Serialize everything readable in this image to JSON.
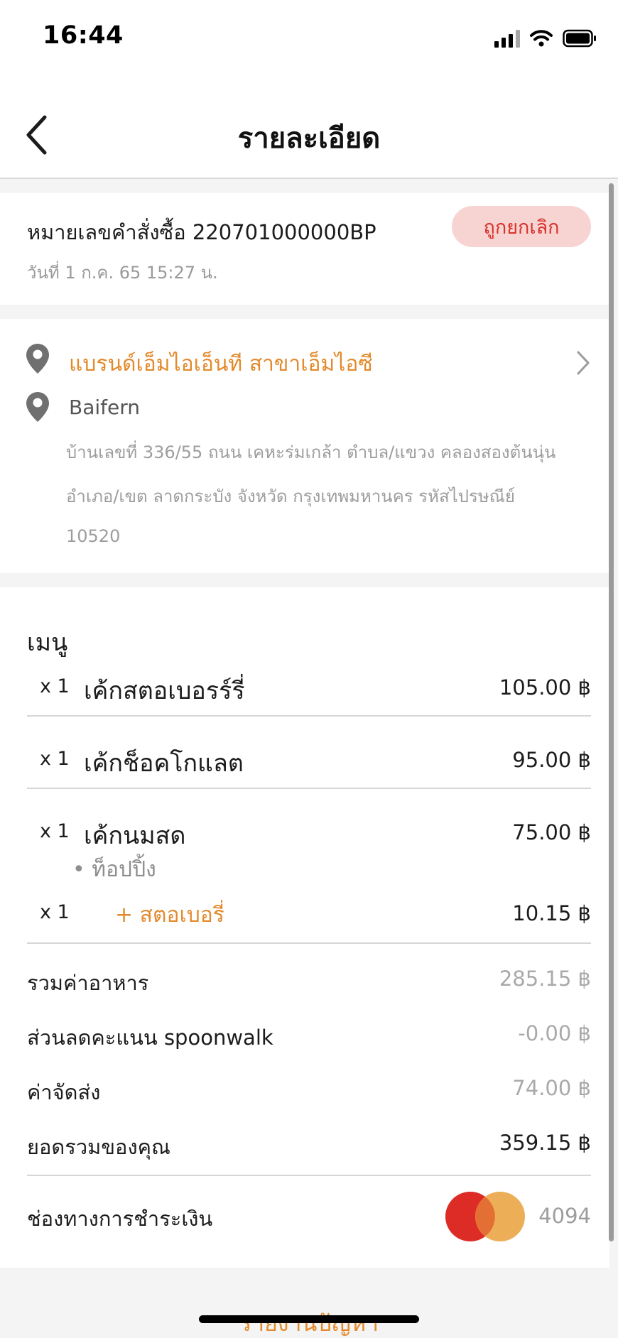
{
  "status_bar": {
    "time": "16:44"
  },
  "nav": {
    "title": "รายละเอียด"
  },
  "order": {
    "number_text": "หมายเลขคำสั่งซื้อ 220701000000BP",
    "date_text": "วันที่ 1 ก.ค. 65 15:27 น.",
    "status": "ถูกยกเลิก"
  },
  "address": {
    "store_name": "แบรนด์เอ็มไอเอ็นที สาขาเอ็มไอซี",
    "customer_name": "Baifern",
    "lines": [
      "บ้านเลขที่ 336/55 ถนน เคหะร่มเกล้า ตำบล/แขวง คลองสองต้นนุ่น",
      "อำเภอ/เขต ลาดกระบัง จังหวัด กรุงเทพมหานคร รหัสไปรษณีย์",
      "10520"
    ]
  },
  "menu": {
    "label": "เมนู",
    "items": [
      {
        "qty": "x 1",
        "name": "เค้กสตอเบอรร์รี่",
        "price": "105.00 ฿"
      },
      {
        "qty": "x 1",
        "name": "เค้กช็อคโกแลต",
        "price": "95.00 ฿"
      },
      {
        "qty": "x 1",
        "name": "เค้กนมสด",
        "price": "75.00 ฿"
      }
    ],
    "topping_header": "• ท็อปปิ้ง",
    "topping": {
      "qty": "x 1",
      "name": "+ สตอเบอรี่",
      "price": "10.15 ฿"
    }
  },
  "summary": {
    "food_label": "รวมค่าอาหาร",
    "food_value": "285.15 ฿",
    "discount_label": "ส่วนลดคะแนน spoonwalk",
    "discount_value": "-0.00 ฿",
    "delivery_label": "ค่าจัดส่ง",
    "delivery_value": "74.00 ฿",
    "total_label": "ยอดรวมของคุณ",
    "total_value": "359.15 ฿"
  },
  "payment": {
    "label": "ช่องทางการชำระเงิน",
    "card_last4": "4094"
  },
  "footer": {
    "report_link": "รายงานปัญหา"
  },
  "colors": {
    "accent": "#e38a2c",
    "cancel_red": "#d9312b",
    "cancel_bg": "#f7d4d2"
  },
  "icons": [
    "back-chevron-icon",
    "location-pin-icon",
    "chevron-right-icon",
    "mastercard-icon",
    "signal-icon",
    "wifi-icon",
    "battery-icon"
  ]
}
